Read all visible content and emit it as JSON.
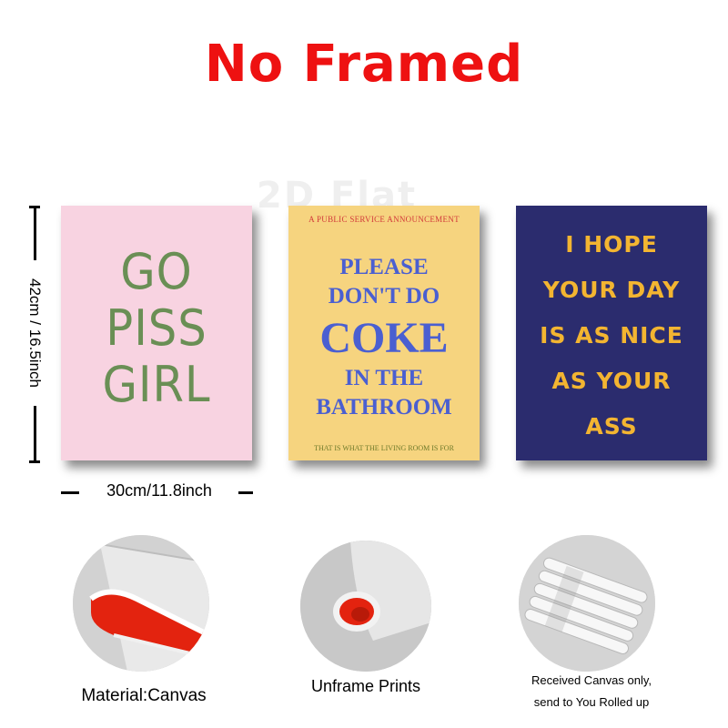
{
  "title": "No Framed",
  "watermark": "2D Flat",
  "posters": {
    "pink": {
      "lines": [
        "GO",
        "PISS",
        "GIRL"
      ],
      "bg": "#f8d3e1",
      "fg": "#6a8f55"
    },
    "yellow": {
      "top_small": "A PUBLIC SERVICE ANNOUNCEMENT",
      "lines": [
        "PLEASE",
        "DON'T DO",
        "COKE",
        "IN THE",
        "BATHROOM"
      ],
      "bottom_small": "THAT IS WHAT THE LIVING ROOM IS FOR",
      "bg": "#f6d47f",
      "fg": "#4a5fd1"
    },
    "navy": {
      "lines": [
        "I HOPE",
        "YOUR DAY",
        "IS AS NICE",
        "AS YOUR",
        "ASS"
      ],
      "bg": "#2b2c6e",
      "fg": "#f3b531"
    }
  },
  "dimensions": {
    "height": "42cm / 16.5inch",
    "width": "30cm/11.8inch"
  },
  "features": [
    {
      "caption": "Material:Canvas"
    },
    {
      "caption": "Unframe  Prints"
    },
    {
      "caption_lines": [
        "Received Canvas only,",
        "send to You Rolled up"
      ]
    }
  ],
  "colors": {
    "title": "#ee1111",
    "canvas_inner": "#e3230f"
  }
}
